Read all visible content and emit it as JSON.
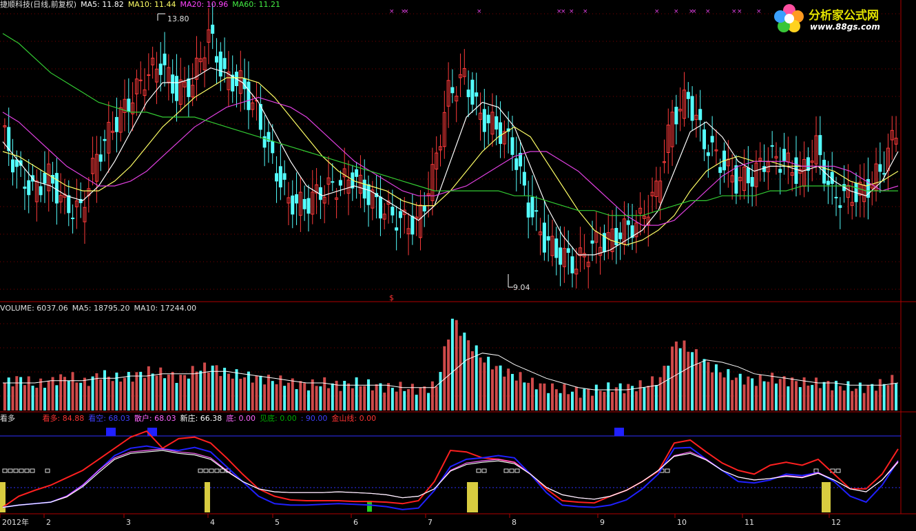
{
  "colors": {
    "up": "#ff3b3b",
    "down": "#54ffff",
    "ma5": "#ffffff",
    "ma10": "#ffff66",
    "ma20": "#e040e0",
    "ma60": "#33cc33",
    "frame": "#b00000",
    "grid": "#800000"
  },
  "price_header": {
    "name": "捷顺科技(日线,前复权)",
    "ma5": "MA5: 11.82",
    "ma10": "MA10: 11.44",
    "ma20": "MA20: 10.96",
    "ma60": "MA60: 11.21"
  },
  "volume_header": {
    "label": "VOLUME: 6037.06",
    "ma5": "MA5: 18795.20",
    "ma10": "MA10: 17244.00"
  },
  "indicator_header": {
    "name": "看多",
    "items": [
      {
        "text": "看多: 84.88",
        "color": "#ff3333"
      },
      {
        "text": "看空: 68.03",
        "color": "#4040ff"
      },
      {
        "text": "散户: 68.03",
        "color": "#ff66ff"
      },
      {
        "text": "新庄: 66.38",
        "color": "#ffffff"
      },
      {
        "text": "底: 0.00",
        "color": "#ff66ff"
      },
      {
        "text": "见底: 0.00",
        "color": "#00aa00"
      },
      {
        "text": ": 90.00",
        "color": "#4040ff"
      },
      {
        "text": "金山线: 0.00",
        "color": "#ff3333"
      }
    ]
  },
  "logo": {
    "title": "分析家公式网",
    "url": "www.88gs.com"
  },
  "annotations": {
    "high": "13.80",
    "low": "9.04",
    "marker": "$"
  },
  "x_axis": {
    "labels": [
      "2012年",
      "2",
      "3",
      "4",
      "5",
      "6",
      "7",
      "8",
      "9",
      "10",
      "11",
      "12"
    ]
  },
  "chart_data": [
    {
      "type": "line",
      "title": "捷顺科技(日线,前复权)",
      "description_series": [
        "price",
        "MA5",
        "MA10",
        "MA20",
        "MA60"
      ],
      "price_range": [
        9.04,
        13.8
      ],
      "series": [
        {
          "name": "price",
          "values": [
            11.9,
            11.0,
            10.6,
            10.9,
            10.3,
            10.2,
            11.3,
            11.9,
            12.4,
            12.9,
            13.2,
            12.6,
            12.8,
            13.8,
            12.9,
            12.8,
            12.2,
            11.2,
            10.4,
            10.3,
            10.6,
            10.7,
            10.9,
            10.5,
            10.2,
            10.0,
            9.9,
            10.9,
            12.6,
            12.9,
            12.1,
            11.9,
            11.5,
            10.3,
            9.6,
            9.3,
            9.1,
            9.5,
            9.6,
            9.8,
            10.0,
            10.6,
            12.1,
            12.5,
            11.6,
            11.2,
            10.8,
            10.9,
            11.3,
            11.2,
            10.9,
            11.5,
            10.5,
            10.5,
            10.6,
            11.0,
            11.8
          ]
        },
        {
          "name": "MA5",
          "values": [
            11.6,
            11.2,
            10.8,
            10.7,
            10.5,
            10.4,
            10.7,
            11.2,
            11.8,
            12.4,
            12.8,
            12.8,
            12.9,
            13.1,
            13.0,
            12.8,
            12.4,
            11.8,
            11.2,
            10.7,
            10.5,
            10.6,
            10.7,
            10.6,
            10.4,
            10.2,
            10.0,
            10.3,
            11.2,
            12.1,
            12.4,
            12.3,
            11.9,
            11.1,
            10.3,
            9.7,
            9.3,
            9.3,
            9.4,
            9.6,
            9.8,
            10.2,
            11.0,
            11.8,
            12.0,
            11.7,
            11.2,
            11.0,
            11.1,
            11.1,
            11.0,
            11.1,
            10.8,
            10.6,
            10.5,
            10.8,
            11.4
          ]
        },
        {
          "name": "MA10",
          "values": [
            11.4,
            11.3,
            11.1,
            10.9,
            10.7,
            10.6,
            10.6,
            10.8,
            11.1,
            11.5,
            11.9,
            12.2,
            12.5,
            12.7,
            12.9,
            12.9,
            12.8,
            12.5,
            12.1,
            11.7,
            11.3,
            11.0,
            10.8,
            10.7,
            10.6,
            10.4,
            10.3,
            10.3,
            10.6,
            11.0,
            11.4,
            11.7,
            11.9,
            11.7,
            11.2,
            10.7,
            10.2,
            9.8,
            9.6,
            9.5,
            9.6,
            9.8,
            10.1,
            10.6,
            11.0,
            11.2,
            11.3,
            11.2,
            11.2,
            11.1,
            11.1,
            11.1,
            11.0,
            10.8,
            10.7,
            10.8,
            11.0
          ]
        },
        {
          "name": "MA20",
          "values": [
            12.2,
            12.0,
            11.7,
            11.4,
            11.1,
            10.9,
            10.7,
            10.7,
            10.8,
            11.0,
            11.3,
            11.6,
            11.9,
            12.1,
            12.3,
            12.4,
            12.5,
            12.4,
            12.3,
            12.1,
            11.8,
            11.5,
            11.2,
            11.0,
            10.8,
            10.6,
            10.5,
            10.5,
            10.6,
            10.7,
            10.9,
            11.1,
            11.3,
            11.4,
            11.4,
            11.2,
            11.0,
            10.7,
            10.4,
            10.1,
            9.9,
            9.9,
            10.0,
            10.3,
            10.6,
            10.9,
            11.1,
            11.2,
            11.2,
            11.2,
            11.1,
            11.1,
            11.1,
            11.0,
            10.8,
            10.6,
            10.7
          ]
        },
        {
          "name": "MA60",
          "values": [
            13.8,
            13.6,
            13.3,
            13.0,
            12.8,
            12.6,
            12.4,
            12.3,
            12.2,
            12.2,
            12.1,
            12.1,
            12.1,
            12.0,
            11.9,
            11.8,
            11.7,
            11.6,
            11.5,
            11.4,
            11.3,
            11.2,
            11.1,
            11.0,
            10.9,
            10.8,
            10.7,
            10.6,
            10.6,
            10.6,
            10.6,
            10.6,
            10.5,
            10.5,
            10.4,
            10.3,
            10.2,
            10.2,
            10.1,
            10.1,
            10.1,
            10.2,
            10.3,
            10.4,
            10.4,
            10.5,
            10.5,
            10.5,
            10.6,
            10.6,
            10.7,
            10.7,
            10.7,
            10.7,
            10.6,
            10.6,
            10.6
          ]
        }
      ]
    },
    {
      "type": "bar",
      "title": "VOLUME",
      "series": [
        {
          "name": "VOLUME",
          "values": [
            12,
            14,
            11,
            13,
            15,
            12,
            16,
            14,
            15,
            17,
            16,
            14,
            18,
            19,
            16,
            15,
            14,
            13,
            12,
            11,
            12,
            11,
            12,
            11,
            10,
            10,
            9,
            11,
            40,
            30,
            22,
            18,
            15,
            12,
            10,
            9,
            8,
            9,
            10,
            10,
            11,
            14,
            30,
            26,
            20,
            16,
            14,
            13,
            14,
            13,
            12,
            12,
            11,
            10,
            10,
            12,
            14
          ]
        },
        {
          "name": "MA5",
          "values": [
            12,
            12,
            12,
            13,
            13,
            13,
            14,
            14,
            15,
            15,
            16,
            16,
            16,
            17,
            17,
            16,
            15,
            14,
            13,
            12,
            12,
            11,
            11,
            11,
            11,
            10,
            10,
            10,
            16,
            22,
            25,
            24,
            20,
            17,
            14,
            12,
            10,
            9,
            9,
            9,
            10,
            11,
            15,
            19,
            22,
            21,
            19,
            16,
            15,
            14,
            13,
            12,
            12,
            11,
            11,
            11,
            12
          ]
        }
      ]
    },
    {
      "type": "line",
      "title": "看多",
      "series": [
        {
          "name": "看多",
          "values": [
            5,
            20,
            28,
            35,
            45,
            55,
            70,
            85,
            100,
            108,
            85,
            98,
            100,
            92,
            72,
            50,
            30,
            20,
            15,
            14,
            14,
            14,
            13,
            13,
            12,
            10,
            14,
            40,
            82,
            80,
            72,
            70,
            66,
            50,
            30,
            14,
            12,
            11,
            20,
            28,
            40,
            54,
            92,
            96,
            80,
            65,
            55,
            50,
            62,
            66,
            62,
            70,
            50,
            30,
            30,
            50,
            84
          ]
        },
        {
          "name": "看空",
          "values": [
            5,
            8,
            10,
            12,
            20,
            35,
            55,
            75,
            85,
            88,
            84,
            82,
            86,
            80,
            60,
            40,
            20,
            10,
            8,
            8,
            9,
            10,
            9,
            8,
            6,
            2,
            4,
            28,
            60,
            70,
            72,
            75,
            72,
            50,
            25,
            8,
            6,
            5,
            8,
            15,
            30,
            50,
            85,
            86,
            70,
            55,
            40,
            38,
            42,
            50,
            48,
            52,
            40,
            20,
            12,
            35,
            68
          ]
        },
        {
          "name": "散户",
          "values": [
            5,
            8,
            10,
            12,
            20,
            35,
            55,
            72,
            80,
            82,
            84,
            80,
            78,
            72,
            55,
            40,
            30,
            26,
            25,
            25,
            25,
            26,
            25,
            24,
            22,
            18,
            20,
            30,
            55,
            65,
            68,
            70,
            66,
            50,
            32,
            22,
            18,
            16,
            20,
            28,
            40,
            55,
            75,
            80,
            70,
            55,
            46,
            42,
            44,
            48,
            46,
            52,
            42,
            30,
            26,
            42,
            68
          ]
        },
        {
          "name": "新庄",
          "values": [
            5,
            8,
            10,
            12,
            19,
            33,
            52,
            70,
            78,
            80,
            82,
            78,
            76,
            70,
            54,
            40,
            30,
            26,
            25,
            25,
            25,
            26,
            25,
            24,
            22,
            18,
            20,
            30,
            54,
            63,
            66,
            68,
            64,
            50,
            32,
            22,
            18,
            16,
            20,
            28,
            40,
            55,
            74,
            78,
            69,
            55,
            46,
            42,
            44,
            47,
            45,
            51,
            42,
            30,
            26,
            42,
            66
          ]
        }
      ]
    }
  ]
}
